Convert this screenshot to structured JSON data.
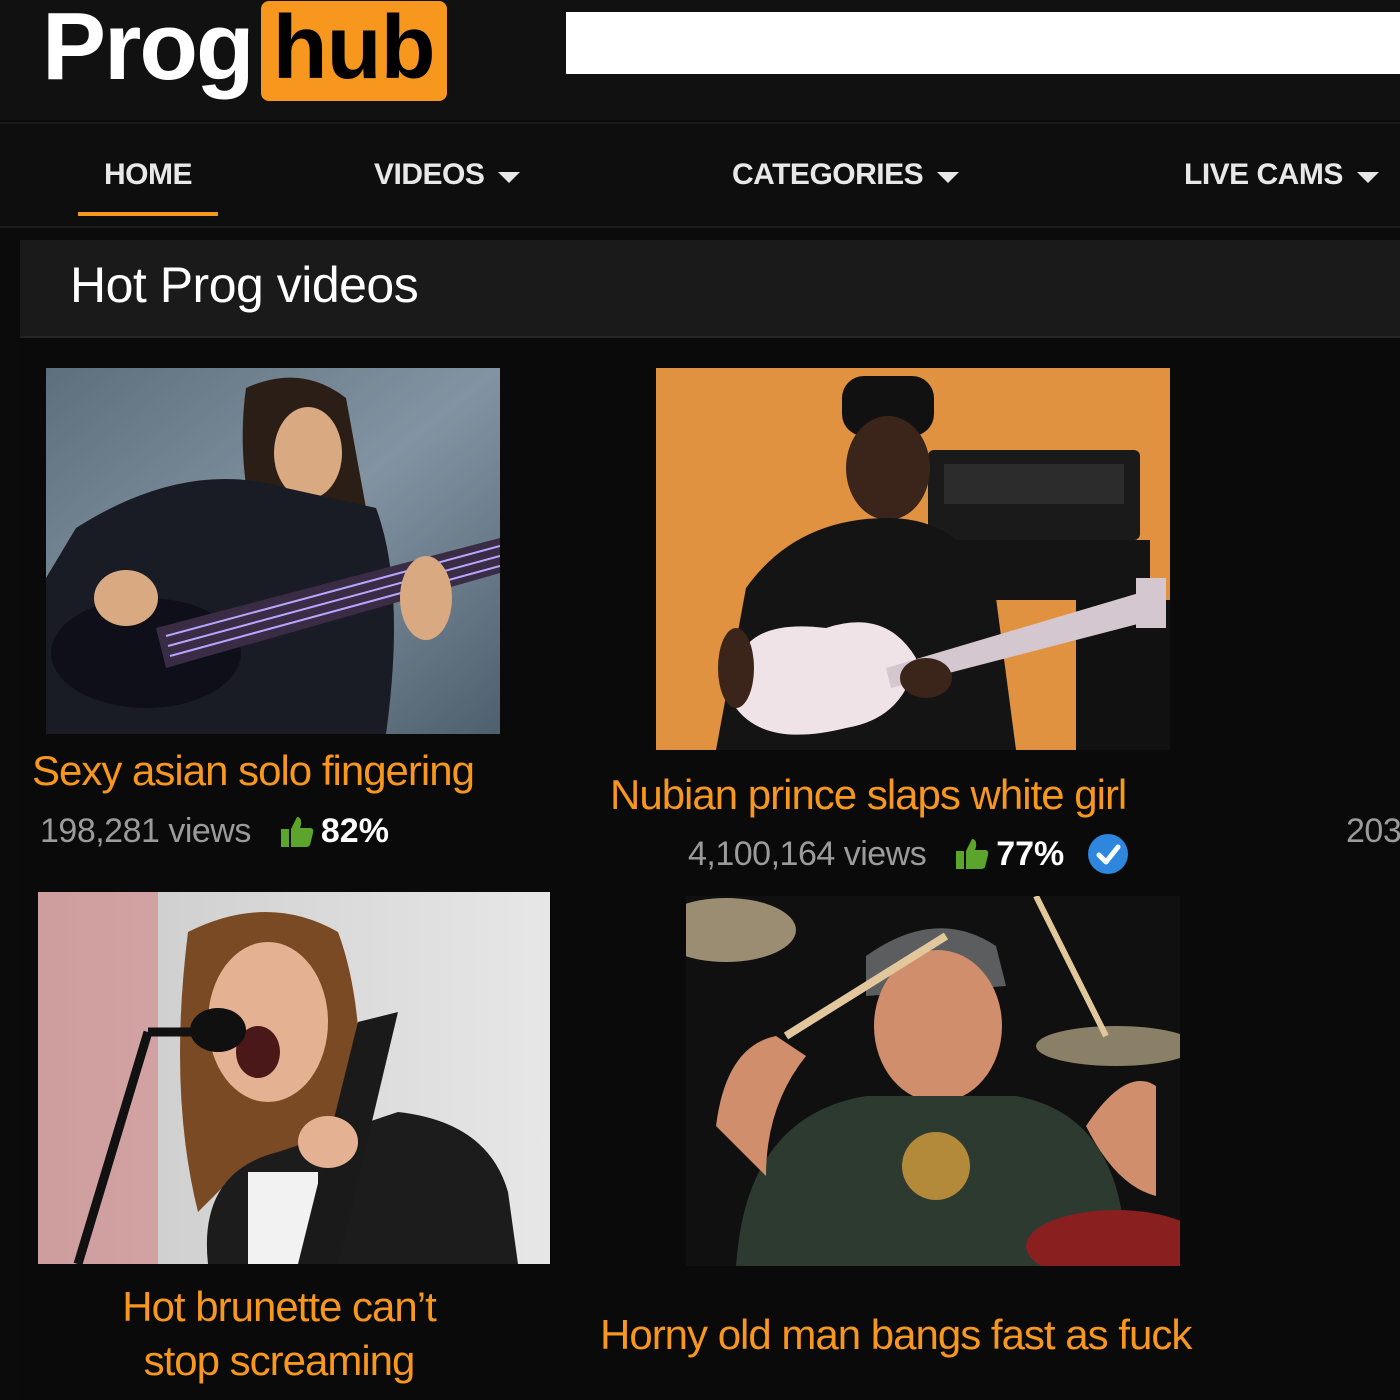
{
  "header": {
    "logo_left": "Prog",
    "logo_right": "hub",
    "search_value": ""
  },
  "nav": {
    "items": [
      {
        "label": "HOME",
        "active": true,
        "dropdown": false
      },
      {
        "label": "VIDEOS",
        "active": false,
        "dropdown": true
      },
      {
        "label": "CATEGORIES",
        "active": false,
        "dropdown": true
      },
      {
        "label": "LIVE CAMS",
        "active": false,
        "dropdown": true
      }
    ]
  },
  "section": {
    "title": "Hot Prog videos"
  },
  "videos": [
    {
      "title": "Sexy asian solo fingering",
      "views": "198,281 views",
      "rating": "82%",
      "verified": false,
      "thumbnail": "bassist with eight-string bass"
    },
    {
      "title": "Nubian prince slaps white girl",
      "views": "4,100,164 views",
      "rating": "77%",
      "verified": true,
      "thumbnail": "guitarist with white guitar and amp"
    },
    {
      "title_line1": "Hot brunette can’t",
      "title_line2": "stop screaming",
      "thumbnail": "long-haired singer at microphone"
    },
    {
      "title": "Horny old man bangs fast as fuck",
      "thumbnail": "drummer with bandana"
    }
  ],
  "offscreen_views_fragment": "203",
  "colors": {
    "accent": "#f7971d",
    "background": "#0b0b0b",
    "views_text": "#9b9b9b",
    "thumbs_up": "#5ba52c",
    "verified": "#2e86de"
  },
  "icons": [
    "thumbs-up-icon",
    "verified-check-icon",
    "chevron-down-icon"
  ]
}
